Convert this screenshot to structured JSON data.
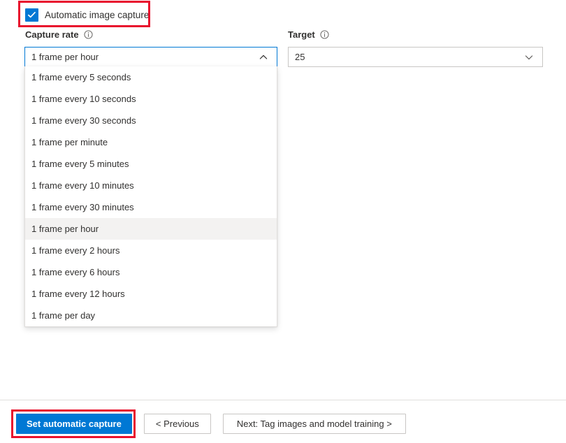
{
  "checkbox": {
    "label": "Automatic image capture",
    "checked": true,
    "accent_color": "#0078d4"
  },
  "capture_rate": {
    "label": "Capture rate",
    "info_icon": "info-circle-icon",
    "selected_value": "1 frame per hour",
    "expanded": true,
    "chevron_icon": "chevron-up-icon",
    "border_color": "#0078d4",
    "options": [
      "1 frame every 5 seconds",
      "1 frame every 10 seconds",
      "1 frame every 30 seconds",
      "1 frame per minute",
      "1 frame every 5 minutes",
      "1 frame every 10 minutes",
      "1 frame every 30 minutes",
      "1 frame per hour",
      "1 frame every 2 hours",
      "1 frame every 6 hours",
      "1 frame every 12 hours",
      "1 frame per day"
    ],
    "highlight_color": "#f3f2f1"
  },
  "target": {
    "label": "Target",
    "info_icon": "info-circle-icon",
    "selected_value": "25",
    "chevron_icon": "chevron-down-icon",
    "border_color": "#c8c6c4"
  },
  "footer": {
    "primary_button": "Set automatic capture",
    "previous_button": "< Previous",
    "next_button": "Next: Tag images and model training >"
  },
  "annotations": {
    "color": "#e8112d",
    "boxes": [
      "automatic-image-capture-checkbox",
      "set-automatic-capture-button"
    ]
  }
}
